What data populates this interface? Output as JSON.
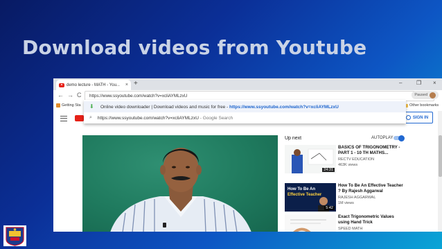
{
  "slide": {
    "title": "Download videos from Youtube"
  },
  "browser": {
    "tab_title": "demo lecture - MATH - You...",
    "tab_close": "×",
    "new_tab": "+",
    "window_controls": [
      "–",
      "❐",
      "×"
    ],
    "nav": {
      "back": "←",
      "forward": "→",
      "reload": "C"
    },
    "address": "https://www.ssyoutube.com/watch?v=xcliAYMLzxU",
    "profile_status": "Paused",
    "bookmarks": {
      "getting_started": "Getting Sta",
      "other_bookmarks": "Other bookmarks"
    }
  },
  "dropdown": {
    "suggestion_1_text": "Online video downloader | Download videos and music for free - ",
    "suggestion_1_url": "https://www.ssyoutube.com/watch?v=xcliAYMLzxU",
    "suggestion_2_text": "https://www.ssyoutube.com/watch?v=xcliAYMLzxU",
    "suggestion_2_suffix": " - Google Search"
  },
  "youtube": {
    "sign_in": "SIGN IN",
    "up_next": "Up next",
    "autoplay": "AUTOPLAY",
    "recommendations": [
      {
        "title": "BASICS OF TRIGONOMETRY - PART 1 - 10 TH MATHS...",
        "channel": "RECTV EDUCATION",
        "views": "463K views",
        "duration": "24:31"
      },
      {
        "title": "How To Be An Effective Teacher ? By Rajesh Aggarwal",
        "channel": "RAJESH AGGARWAL",
        "views": "1M views",
        "duration": "5:42",
        "thumb_text_1": "How To Be An",
        "thumb_text_2": "Effective Teacher"
      },
      {
        "title": "Exact Trigonometric Values using Hand Trick",
        "channel": "SPEED MATH",
        "views": ""
      }
    ]
  },
  "colors": {
    "accent_blue": "#2168d1",
    "youtube_red": "#e62117",
    "board_green": "#1f7a5e"
  }
}
